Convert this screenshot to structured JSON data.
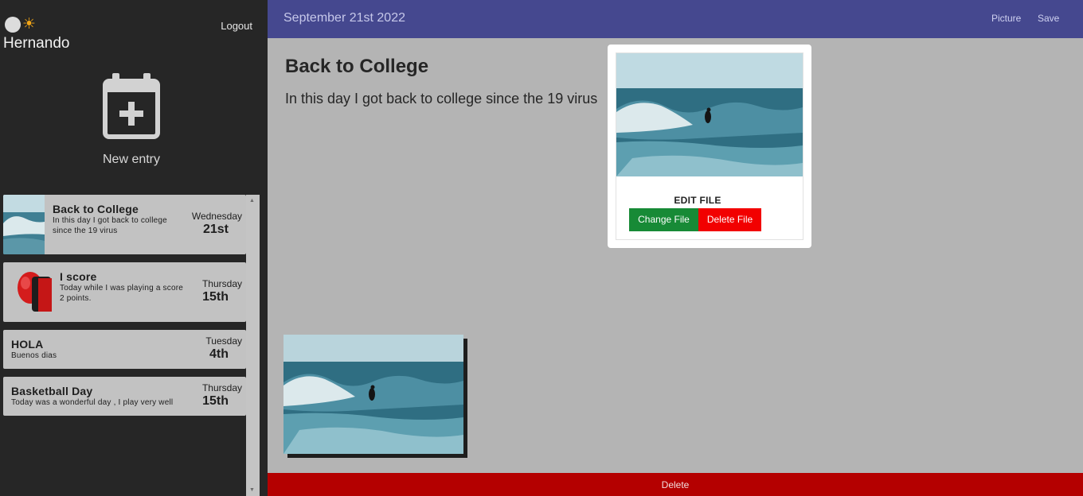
{
  "sidebar": {
    "theme_icon": "sun-icon",
    "username": "Hernando",
    "logout_label": "Logout",
    "new_entry_label": "New entry",
    "new_entry_icon": "calendar-plus-icon",
    "entries": [
      {
        "title": "Back to College",
        "excerpt": "In this day I got back to college since the 19 virus",
        "day": "Wednesday",
        "date": "21st",
        "thumbnail": "surfer-wave-photo"
      },
      {
        "title": "I score",
        "excerpt": "Today while I was playing a score 2 points.",
        "day": "Thursday",
        "date": "15th",
        "thumbnail": "red-boxing-glove-photo"
      },
      {
        "title": "HOLA",
        "excerpt": "Buenos dias",
        "day": "Tuesday",
        "date": "4th"
      },
      {
        "title": "Basketball Day",
        "excerpt": "Today was a wonderful day , I play very well",
        "day": "Thursday",
        "date": "15th"
      }
    ]
  },
  "header": {
    "date": "September 21st 2022",
    "picture_label": "Picture",
    "save_label": "Save"
  },
  "main": {
    "title": "Back to College",
    "body": "In this day I got back to college since the 19 virus",
    "photo": "surfer-wave-photo"
  },
  "footer": {
    "delete_label": "Delete"
  },
  "modal": {
    "title": "EDIT FILE",
    "change_label": "Change File",
    "delete_label": "Delete File",
    "photo": "surfer-wave-photo"
  },
  "colors": {
    "header_bg": "#45488f",
    "sidebar_bg": "#262626",
    "delete_bar": "#b40000",
    "change_button": "#178a36",
    "delete_button": "#f20000"
  }
}
